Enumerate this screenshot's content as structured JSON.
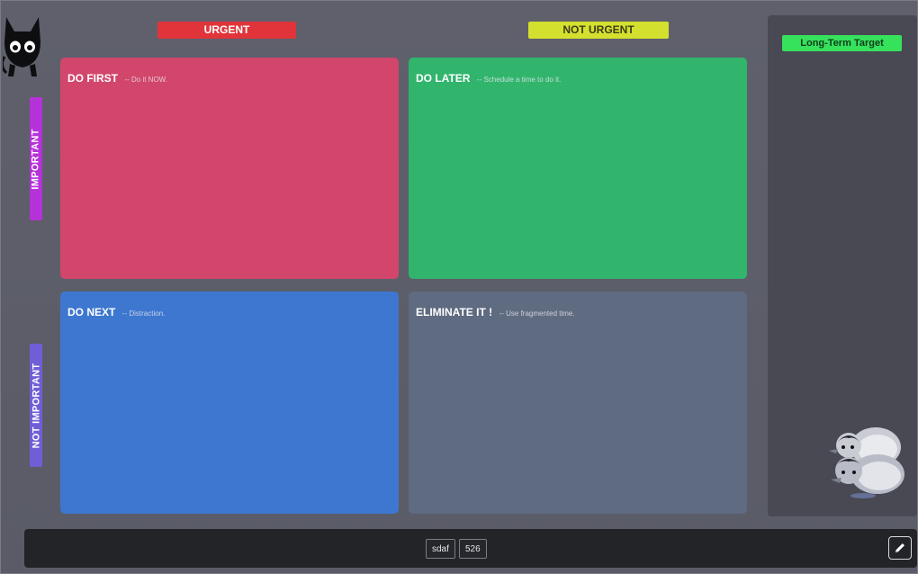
{
  "columns": {
    "urgent": "URGENT",
    "not_urgent": "NOT URGENT"
  },
  "rows": {
    "important": "IMPORTANT",
    "not_important": "NOT IMPORTANT"
  },
  "quadrants": [
    {
      "title": "DO FIRST",
      "hint": "-- Do it NOW.",
      "color": "#d2466b"
    },
    {
      "title": "DO LATER",
      "hint": "-- Schedule a time to do it.",
      "color": "#31b56d"
    },
    {
      "title": "DO NEXT",
      "hint": "-- Distraction.",
      "color": "#3d77cf"
    },
    {
      "title": "ELIMINATE IT !",
      "hint": "-- Use fragmented time.",
      "color": "#5f6b81"
    }
  ],
  "sidebar": {
    "target_label": "Long-Term Target"
  },
  "bottom_bar": {
    "chip_1": "sdaf",
    "chip_2": "526"
  },
  "icons": {
    "logo": "black-cat-icon",
    "mascot": "penguins-icon",
    "edit": "pencil-icon"
  },
  "colors": {
    "urgent": "#e0343a",
    "not_urgent": "#d4e02e",
    "important": "#b532d8",
    "not_important": "#6e5fd6",
    "target": "#36e15b"
  }
}
